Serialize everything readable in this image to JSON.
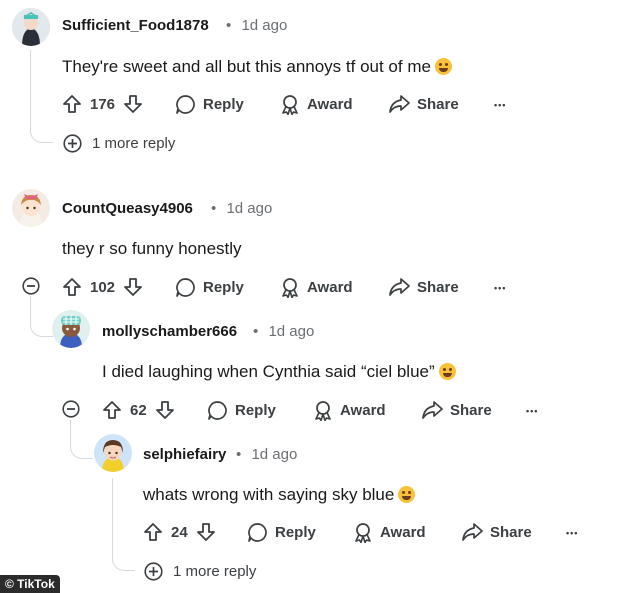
{
  "comments": [
    {
      "username": "Sufficient_Food1878",
      "time": "1d ago",
      "text": "They're sweet and all but this annoys tf out of me",
      "emoji": "rofl-emoji",
      "votes": "176",
      "more_replies": "1 more reply"
    },
    {
      "username": "CountQueasy4906",
      "time": "1d ago",
      "text": "they r so funny honestly",
      "votes": "102"
    },
    {
      "username": "mollyschamber666",
      "time": "1d ago",
      "text": "I died laughing when Cynthia said “ciel blue”",
      "emoji": "grinning-sweat-emoji",
      "votes": "62"
    },
    {
      "username": "selphiefairy",
      "time": "1d ago",
      "text": "whats wrong with saying sky blue",
      "emoji": "crying-emoji",
      "votes": "24",
      "more_replies": "1 more reply"
    }
  ],
  "actions": {
    "reply": "Reply",
    "award": "Award",
    "share": "Share",
    "more": "•••"
  },
  "meta_separator": "•",
  "watermark": "© TikTok",
  "colors": {
    "text": "#1a1a1b",
    "meta": "#6b6f73",
    "thread_line": "#d7dadc"
  }
}
